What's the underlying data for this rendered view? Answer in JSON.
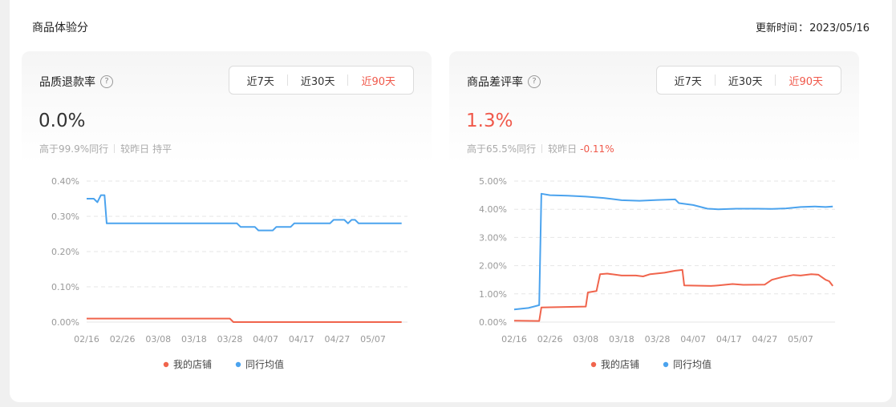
{
  "header": {
    "title": "商品体验分",
    "update_label": "更新时间",
    "update_date": "2023/05/16"
  },
  "ranges": [
    "近7天",
    "近30天",
    "近90天"
  ],
  "cards": [
    {
      "title": "品质退款率",
      "value": "0.0%",
      "beat_text": "高于99.9%同行",
      "compare_label": "较昨日",
      "compare_value": "持平"
    },
    {
      "title": "商品差评率",
      "value": "1.3%",
      "beat_text": "高于65.5%同行",
      "compare_label": "较昨日",
      "compare_value": "-0.11%"
    }
  ],
  "colors": {
    "my_store": "#f0644c",
    "industry_avg": "#4ba3ee",
    "accent_red": "#f0584a"
  },
  "chart_data": [
    {
      "type": "line",
      "x_ticks": [
        "02/16",
        "02/26",
        "03/08",
        "03/18",
        "03/28",
        "04/07",
        "04/17",
        "04/27",
        "05/07"
      ],
      "y_ticks": [
        "0.00%",
        "0.10%",
        "0.20%",
        "0.30%",
        "0.40%"
      ],
      "ylim": [
        0,
        0.4
      ],
      "grid": true,
      "legend_position": "bottom",
      "series": [
        {
          "name": "我的店铺",
          "color": "#f0644c",
          "points": [
            [
              0,
              0.01
            ],
            [
              40,
              0.01
            ],
            [
              41,
              0
            ],
            [
              88,
              0
            ]
          ]
        },
        {
          "name": "同行均值",
          "color": "#4ba3ee",
          "points": [
            [
              0,
              0.35
            ],
            [
              2,
              0.35
            ],
            [
              3,
              0.34
            ],
            [
              4,
              0.36
            ],
            [
              5,
              0.36
            ],
            [
              5.6,
              0.28
            ],
            [
              42,
              0.28
            ],
            [
              43,
              0.27
            ],
            [
              47,
              0.27
            ],
            [
              48,
              0.26
            ],
            [
              52,
              0.26
            ],
            [
              53,
              0.27
            ],
            [
              57,
              0.27
            ],
            [
              58,
              0.28
            ],
            [
              68,
              0.28
            ],
            [
              69,
              0.29
            ],
            [
              72,
              0.29
            ],
            [
              73,
              0.28
            ],
            [
              74,
              0.29
            ],
            [
              75,
              0.29
            ],
            [
              76,
              0.28
            ],
            [
              88,
              0.28
            ]
          ]
        }
      ]
    },
    {
      "type": "line",
      "x_ticks": [
        "02/16",
        "02/26",
        "03/08",
        "03/18",
        "03/28",
        "04/07",
        "04/17",
        "04/27",
        "05/07"
      ],
      "y_ticks": [
        "0.00%",
        "1.00%",
        "2.00%",
        "3.00%",
        "4.00%",
        "5.00%"
      ],
      "ylim": [
        0,
        5
      ],
      "grid": true,
      "legend_position": "bottom",
      "series": [
        {
          "name": "我的店铺",
          "color": "#f0644c",
          "points": [
            [
              0,
              0.05
            ],
            [
              7,
              0.04
            ],
            [
              7.6,
              0.52
            ],
            [
              20,
              0.55
            ],
            [
              20.6,
              1.05
            ],
            [
              23,
              1.1
            ],
            [
              24,
              1.7
            ],
            [
              26,
              1.72
            ],
            [
              30,
              1.65
            ],
            [
              34,
              1.65
            ],
            [
              36,
              1.62
            ],
            [
              38,
              1.7
            ],
            [
              42,
              1.75
            ],
            [
              45,
              1.82
            ],
            [
              47,
              1.85
            ],
            [
              47.5,
              1.3
            ],
            [
              55,
              1.28
            ],
            [
              57,
              1.3
            ],
            [
              61,
              1.35
            ],
            [
              64,
              1.32
            ],
            [
              70,
              1.33
            ],
            [
              72,
              1.5
            ],
            [
              75,
              1.6
            ],
            [
              78,
              1.67
            ],
            [
              80,
              1.65
            ],
            [
              83,
              1.7
            ],
            [
              85,
              1.68
            ],
            [
              87,
              1.5
            ],
            [
              88,
              1.45
            ],
            [
              89,
              1.28
            ]
          ]
        },
        {
          "name": "同行均值",
          "color": "#4ba3ee",
          "points": [
            [
              0,
              0.45
            ],
            [
              4,
              0.5
            ],
            [
              7,
              0.6
            ],
            [
              7.6,
              4.55
            ],
            [
              10,
              4.5
            ],
            [
              15,
              4.48
            ],
            [
              20,
              4.45
            ],
            [
              25,
              4.4
            ],
            [
              30,
              4.32
            ],
            [
              35,
              4.3
            ],
            [
              40,
              4.33
            ],
            [
              45,
              4.35
            ],
            [
              46,
              4.22
            ],
            [
              50,
              4.15
            ],
            [
              54,
              4.02
            ],
            [
              57,
              4.0
            ],
            [
              62,
              4.02
            ],
            [
              68,
              4.02
            ],
            [
              72,
              4.01
            ],
            [
              76,
              4.03
            ],
            [
              80,
              4.08
            ],
            [
              84,
              4.1
            ],
            [
              87,
              4.08
            ],
            [
              89,
              4.1
            ]
          ]
        }
      ]
    }
  ]
}
